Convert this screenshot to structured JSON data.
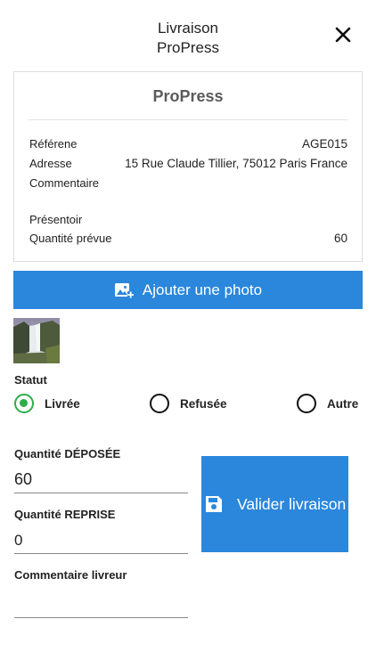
{
  "header": {
    "title_line1": "Livraison",
    "title_line2": "ProPress",
    "close_icon": "close-icon"
  },
  "card": {
    "title": "ProPress",
    "reference_label": "Référene",
    "reference_value": "AGE015",
    "address_label": "Adresse",
    "address_value": "15 Rue Claude Tillier, 75012 Paris France",
    "comment_label": "Commentaire",
    "presentoir_label": "Présentoir",
    "planned_qty_label": "Quantité prévue",
    "planned_qty_value": "60"
  },
  "photo": {
    "button_label": "Ajouter une photo",
    "icon": "add-photo-icon"
  },
  "status": {
    "label": "Statut",
    "options": [
      {
        "label": "Livrée",
        "checked": true
      },
      {
        "label": "Refusée",
        "checked": false
      },
      {
        "label": "Autre",
        "checked": false
      }
    ],
    "accent_color": "#2eac4a"
  },
  "form": {
    "deposited_label": "Quantité DÉPOSÉE",
    "deposited_value": "60",
    "returned_label": "Quantité REPRISE",
    "returned_value": "0",
    "driver_comment_label": "Commentaire livreur",
    "driver_comment_value": ""
  },
  "validate": {
    "label": "Valider livraison",
    "icon": "save-icon"
  },
  "colors": {
    "primary": "#2a87dc",
    "card_title": "#5b5b5b"
  }
}
